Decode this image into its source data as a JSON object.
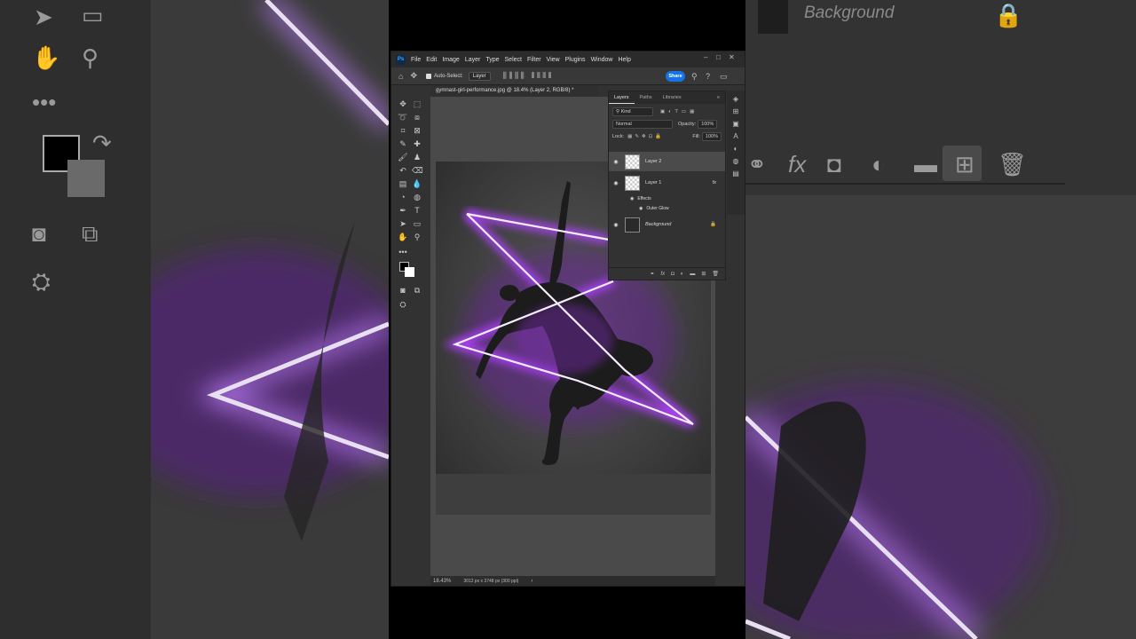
{
  "backdrop": {
    "left_text": "Background",
    "tool_icons": [
      "arrow-icon",
      "marquee-icon",
      "hand-icon",
      "zoom-icon"
    ],
    "panel_icons": [
      "link-icon",
      "fx-icon",
      "mask-icon",
      "adjustment-icon",
      "folder-icon",
      "new-layer-icon",
      "trash-icon"
    ],
    "fx_label": "fx"
  },
  "menubar": {
    "logo": "Ps",
    "items": [
      "File",
      "Edit",
      "Image",
      "Layer",
      "Type",
      "Select",
      "Filter",
      "View",
      "Plugins",
      "Window",
      "Help"
    ]
  },
  "options": {
    "auto_select_label": "Auto-Select:",
    "auto_select_value": "Layer",
    "share_label": "Share"
  },
  "document": {
    "tab_title": "gymnast-girl-performance.jpg @ 18.4% (Layer 2, RGB/8) *",
    "zoom": "18.43%",
    "doc_info": "3012 px x 3748 px (300 ppi)"
  },
  "layers_panel": {
    "tabs": [
      "Layers",
      "Paths",
      "Libraries"
    ],
    "filter_label": "Kind",
    "blend_mode": "Normal",
    "opacity_label": "Opacity:",
    "opacity_value": "100%",
    "lock_label": "Lock:",
    "fill_label": "Fill:",
    "fill_value": "100%",
    "layers": [
      {
        "name": "Layer 2",
        "selected": true
      },
      {
        "name": "Layer 1",
        "fx": "fx",
        "effects_label": "Effects",
        "effect": "Outer Glow"
      },
      {
        "name": "Background",
        "locked": true
      }
    ]
  },
  "colors": {
    "glow": "#b040ff",
    "accent": "#1473e6",
    "panel": "#323232"
  }
}
